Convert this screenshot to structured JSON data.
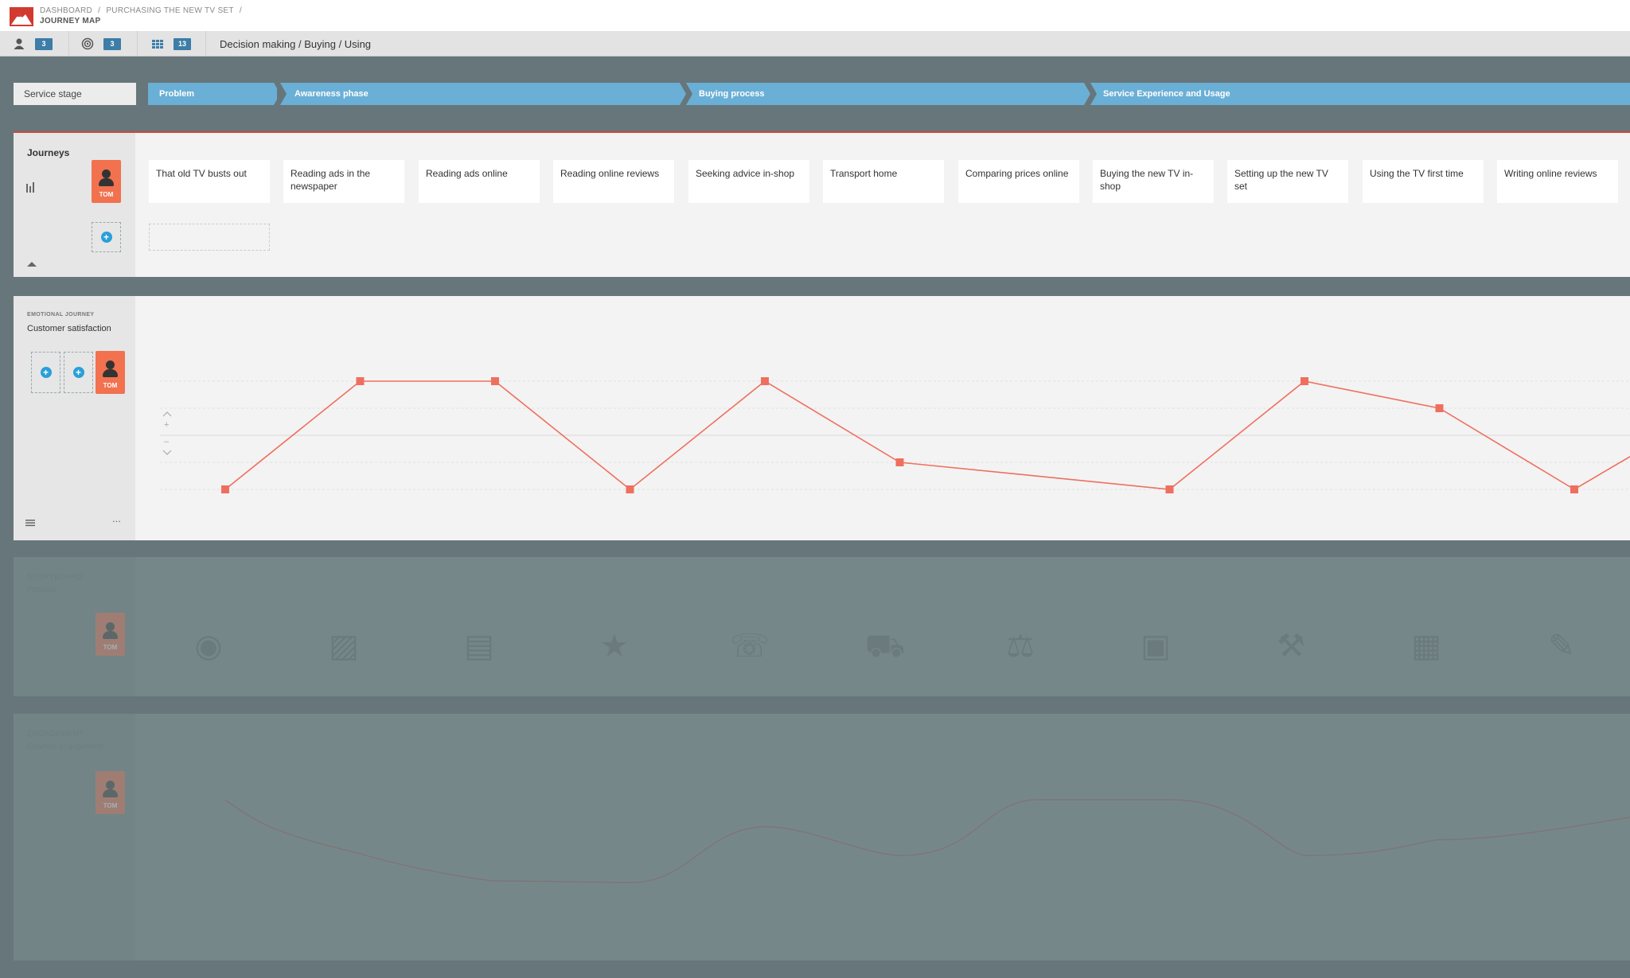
{
  "header": {
    "breadcrumb": [
      "DASHBOARD",
      "/",
      "PURCHASING THE NEW TV SET",
      "/"
    ],
    "title": "JOURNEY MAP"
  },
  "toolbar": {
    "personas_count": "3",
    "goals_count": "3",
    "steps_count": "13",
    "path": "Decision making / Buying / Using"
  },
  "stages": {
    "label": "Service stage",
    "items": [
      "Problem",
      "Awareness phase",
      "Buying process",
      "Service Experience and Usage"
    ]
  },
  "journeys": {
    "title": "Journeys",
    "persona": "TOM",
    "steps": [
      "That old TV busts out",
      "Reading ads in the newspaper",
      "Reading ads online",
      "Reading online reviews",
      "Seeking advice in-shop",
      "Transport  home",
      "Comparing prices online",
      "Buying the new TV in-shop",
      "Setting up the new TV set",
      "Using the TV first time",
      "Writing online reviews"
    ]
  },
  "emotional": {
    "caption": "EMOTIONAL JOURNEY",
    "title": "Customer satisfaction",
    "persona": "TOM",
    "more": "..."
  },
  "chart_data": {
    "type": "line",
    "categories": [
      "That old TV busts out",
      "Reading ads in the newspaper",
      "Reading ads online",
      "Reading online reviews",
      "Seeking advice in-shop",
      "Transport  home",
      "Comparing prices online",
      "Buying the new TV in-shop",
      "Setting up the new TV set",
      "Using the TV first time",
      "Writing online reviews"
    ],
    "series": [
      {
        "values": [
          -2,
          2,
          2,
          -2,
          2,
          -1,
          null,
          -2,
          2,
          1,
          -2
        ],
        "color": "#ef6f5f"
      }
    ],
    "ylim": [
      -2,
      2
    ],
    "grid": true
  },
  "faded": {
    "pictos_caption": "STORYBOARD",
    "pictos_title": "Pictures",
    "engage_caption": "ENGAGEMENT",
    "engage_title": "Channel engagement",
    "persona": "TOM"
  },
  "icons": {
    "logo": "mountain-logo",
    "personas": "person-icon",
    "goals": "target-icon",
    "steps": "grid-icon",
    "collapse": "chevron-up-icon",
    "stats": "bar-chart-icon",
    "menu": "hamburger-icon"
  },
  "colors": {
    "accent": "#2a9fd8",
    "stage": "#6aafd6",
    "persona": "#f2714f",
    "line": "#ef6f5f",
    "badge": "#3d7da8"
  }
}
